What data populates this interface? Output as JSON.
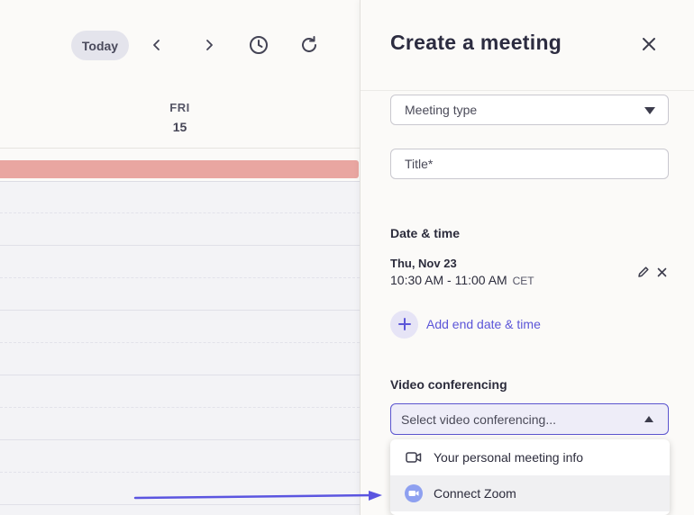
{
  "calendar": {
    "today_label": "Today",
    "prev_icon": "chevron-left-icon",
    "next_icon": "chevron-right-icon",
    "history_icon": "clock-icon",
    "refresh_icon": "refresh-icon",
    "day_name": "FRI",
    "day_number": "15",
    "event_color": "#e9a6a1"
  },
  "panel": {
    "title": "Create a meeting",
    "close_icon": "close-icon",
    "meeting_type_placeholder": "Meeting type",
    "title_placeholder": "Title*",
    "date_time_label": "Date & time",
    "date": "Thu, Nov 23",
    "time_range": "10:30 AM - 11:00 AM",
    "timezone": "CET",
    "add_end_label": "Add end date & time",
    "video_label": "Video conferencing",
    "video_select_placeholder": "Select video conferencing...",
    "options": [
      {
        "label": "Your personal meeting info",
        "icon": "video-camera-icon"
      },
      {
        "label": "Connect Zoom",
        "icon": "zoom-icon"
      }
    ],
    "accent_color": "#5b55d8"
  }
}
